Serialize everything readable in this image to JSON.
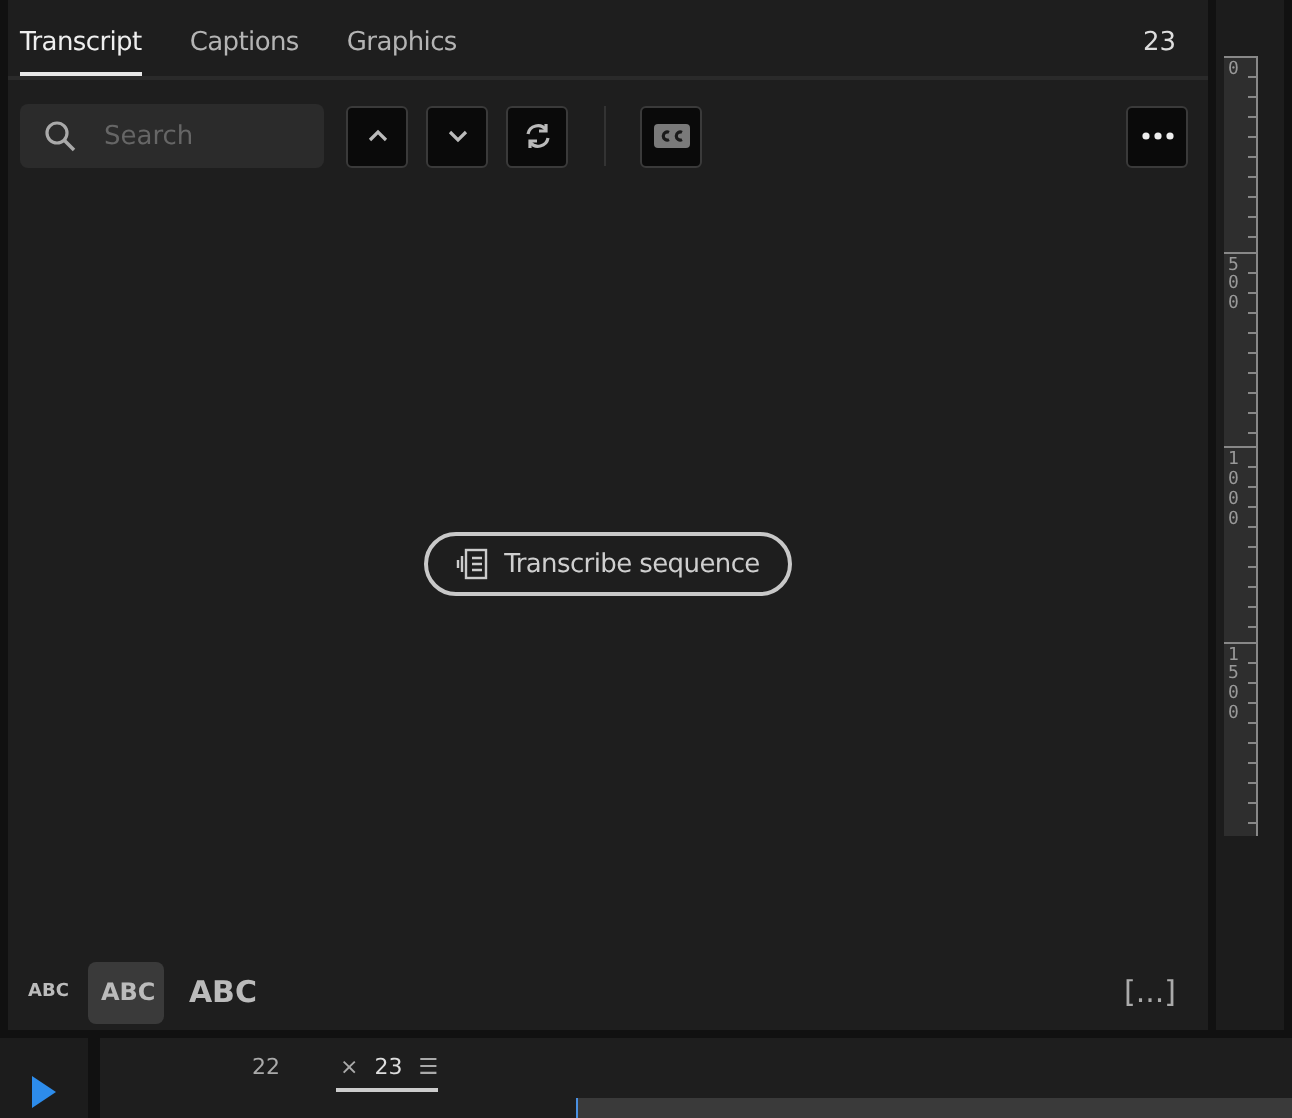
{
  "tabs": [
    {
      "label": "Transcript",
      "selected": true
    },
    {
      "label": "Captions",
      "selected": false
    },
    {
      "label": "Graphics",
      "selected": false
    }
  ],
  "sequence_number": "23",
  "search": {
    "placeholder": "Search"
  },
  "transcribe_button": "Transcribe sequence",
  "text_sizes": [
    {
      "label": "ABC",
      "selected": false
    },
    {
      "label": "ABC",
      "selected": true
    },
    {
      "label": "ABC",
      "selected": false
    }
  ],
  "expand_button": "[...]",
  "ruler_labels": [
    "0",
    "500",
    "1000",
    "1500"
  ],
  "timeline_tabs": [
    {
      "label": "22",
      "selected": false
    },
    {
      "label": "23",
      "selected": true,
      "close": "×",
      "menu": "☰"
    }
  ]
}
